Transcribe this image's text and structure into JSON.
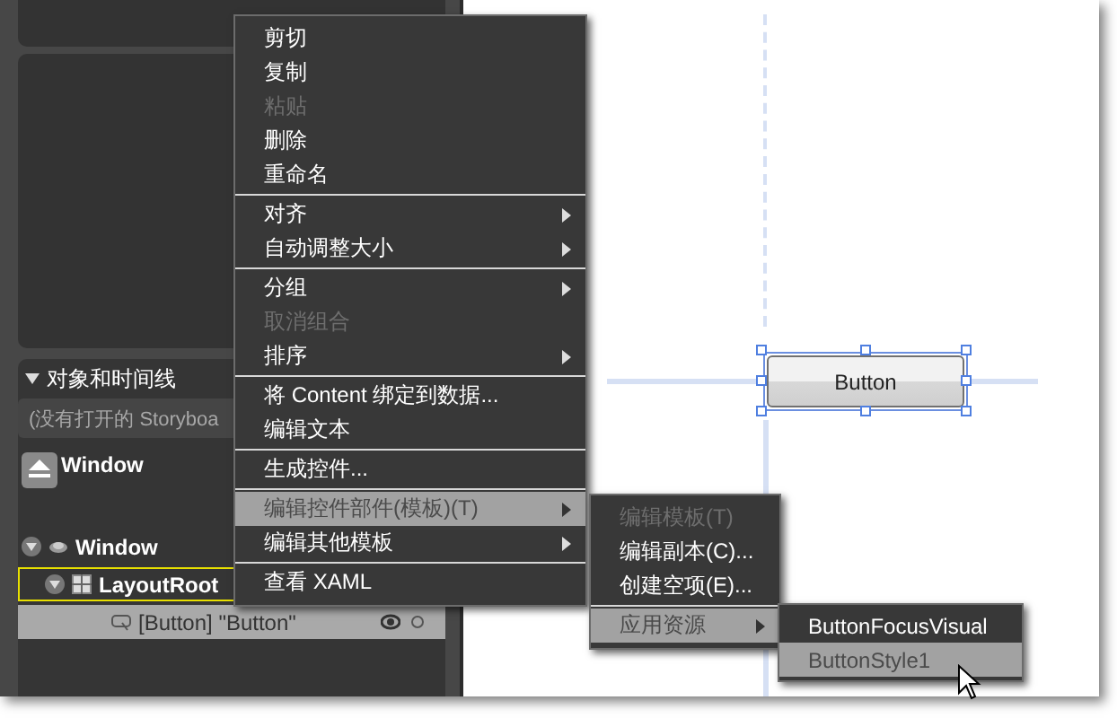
{
  "objects_panel": {
    "title": "对象和时间线",
    "expanded": true,
    "storyboard_placeholder": "(没有打开的 Storyboa",
    "scope": "Window",
    "tree": [
      {
        "label": "Window",
        "kind": "window",
        "expanded": true,
        "active": false,
        "selected": false,
        "children": [
          {
            "label": "LayoutRoot",
            "kind": "grid",
            "expanded": true,
            "active": true,
            "selected": false,
            "children": [
              {
                "label": "[Button] \"Button\"",
                "kind": "button",
                "active": false,
                "selected": true
              }
            ]
          }
        ]
      }
    ]
  },
  "canvas": {
    "button_label": "Button"
  },
  "context_menu": [
    {
      "kind": "item",
      "label": "剪切",
      "disabled": false,
      "submenu": false,
      "selected": false
    },
    {
      "kind": "item",
      "label": "复制",
      "disabled": false,
      "submenu": false,
      "selected": false
    },
    {
      "kind": "item",
      "label": "粘贴",
      "disabled": true,
      "submenu": false,
      "selected": false
    },
    {
      "kind": "item",
      "label": "删除",
      "disabled": false,
      "submenu": false,
      "selected": false
    },
    {
      "kind": "item",
      "label": "重命名",
      "disabled": false,
      "submenu": false,
      "selected": false
    },
    {
      "kind": "separator"
    },
    {
      "kind": "item",
      "label": "对齐",
      "disabled": false,
      "submenu": true,
      "selected": false
    },
    {
      "kind": "item",
      "label": "自动调整大小",
      "disabled": false,
      "submenu": true,
      "selected": false
    },
    {
      "kind": "separator"
    },
    {
      "kind": "item",
      "label": "分组",
      "disabled": false,
      "submenu": true,
      "selected": false
    },
    {
      "kind": "item",
      "label": "取消组合",
      "disabled": true,
      "submenu": false,
      "selected": false
    },
    {
      "kind": "item",
      "label": "排序",
      "disabled": false,
      "submenu": true,
      "selected": false
    },
    {
      "kind": "separator"
    },
    {
      "kind": "item",
      "label": "将 Content 绑定到数据...",
      "disabled": false,
      "submenu": false,
      "selected": false
    },
    {
      "kind": "item",
      "label": "编辑文本",
      "disabled": false,
      "submenu": false,
      "selected": false
    },
    {
      "kind": "separator"
    },
    {
      "kind": "item",
      "label": "生成控件...",
      "disabled": false,
      "submenu": false,
      "selected": false
    },
    {
      "kind": "separator"
    },
    {
      "kind": "item",
      "label": "编辑控件部件(模板)(T)",
      "disabled": false,
      "submenu": true,
      "selected": true
    },
    {
      "kind": "item",
      "label": "编辑其他模板",
      "disabled": false,
      "submenu": true,
      "selected": false
    },
    {
      "kind": "separator"
    },
    {
      "kind": "item",
      "label": "查看 XAML",
      "disabled": false,
      "submenu": false,
      "selected": false
    }
  ],
  "template_submenu": [
    {
      "kind": "item",
      "label": "编辑模板(T)",
      "disabled": true,
      "submenu": false,
      "selected": false
    },
    {
      "kind": "item",
      "label": "编辑副本(C)...",
      "disabled": false,
      "submenu": false,
      "selected": false
    },
    {
      "kind": "item",
      "label": "创建空项(E)...",
      "disabled": false,
      "submenu": false,
      "selected": false
    },
    {
      "kind": "separator"
    },
    {
      "kind": "item",
      "label": "应用资源",
      "disabled": false,
      "submenu": true,
      "selected": true
    }
  ],
  "resource_submenu": [
    {
      "kind": "item",
      "label": "ButtonFocusVisual",
      "disabled": false,
      "submenu": false,
      "selected": false
    },
    {
      "kind": "item",
      "label": "ButtonStyle1",
      "disabled": false,
      "submenu": false,
      "selected": true
    }
  ]
}
